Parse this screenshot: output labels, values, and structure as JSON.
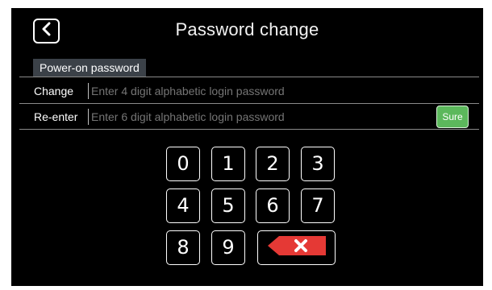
{
  "header": {
    "title": "Password change",
    "back_icon": "chevron-left-icon"
  },
  "section": {
    "tab_label": "Power-on password"
  },
  "form": {
    "change_label": "Change",
    "change_placeholder": "Enter 4 digit alphabetic login password",
    "reenter_label": "Re-enter",
    "reenter_placeholder": "Enter 6 digit alphabetic login password",
    "confirm_label": "Sure"
  },
  "keypad": {
    "keys": [
      "0",
      "1",
      "2",
      "3",
      "4",
      "5",
      "6",
      "7",
      "8",
      "9"
    ],
    "delete_icon": "backspace-icon"
  },
  "colors": {
    "background": "#000000",
    "accent": "#5cb85c",
    "delete": "#e53935",
    "tab_bg": "#3b4148"
  }
}
